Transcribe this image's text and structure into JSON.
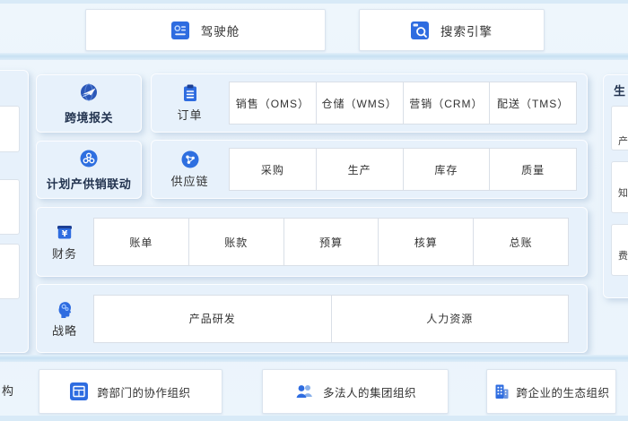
{
  "colors": {
    "accent_blue": "#2e6ce0",
    "dark_navy": "#1c3f94",
    "panel_bg": "#e7f1fb",
    "page_bg": "#eef6fc",
    "divider": "#c8e1f3",
    "cell_border": "#d9dfe7",
    "text": "#333333",
    "title_text": "#22334f"
  },
  "header": {
    "items": [
      {
        "label": "驾驶舱",
        "icon": "dashboard-icon"
      },
      {
        "label": "搜索引擎",
        "icon": "search-engine-icon"
      }
    ]
  },
  "left_cards": [
    {
      "label": "跨境报关",
      "icon": "globe-plane-icon"
    },
    {
      "label": "计划产供销联动",
      "icon": "cloud-link-icon"
    }
  ],
  "rows": [
    {
      "label": "订单",
      "icon": "order-clipboard-icon",
      "cells": [
        "销售（OMS）",
        "仓储（WMS）",
        "营销（CRM）",
        "配送（TMS）"
      ]
    },
    {
      "label": "供应链",
      "icon": "supply-chain-network-icon",
      "cells": [
        "采购",
        "生产",
        "库存",
        "质量"
      ]
    },
    {
      "label": "财务",
      "icon": "finance-cashbox-icon",
      "cells": [
        "账单",
        "账款",
        "预算",
        "核算",
        "总账"
      ]
    },
    {
      "label": "战略",
      "icon": "strategy-head-icon",
      "cells": [
        "产品研发",
        "人力资源"
      ]
    }
  ],
  "right_panel": {
    "title": "生",
    "partial_cells": [
      "产",
      "知",
      "费"
    ]
  },
  "left_edge": {
    "bottom_partial_char": "构"
  },
  "footer": {
    "items": [
      {
        "label": "跨部门的协作组织",
        "icon": "collaboration-grid-icon"
      },
      {
        "label": "多法人的集团组织",
        "icon": "group-people-icon"
      },
      {
        "label": "跨企业的生态组织",
        "icon": "enterprise-building-icon"
      }
    ]
  }
}
